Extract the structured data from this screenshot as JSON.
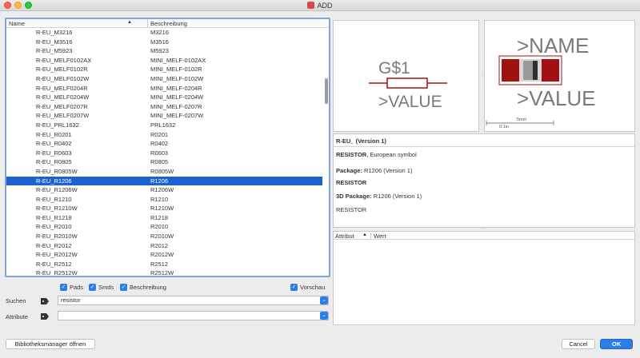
{
  "window": {
    "title": "ADD"
  },
  "list": {
    "columns": {
      "name": "Name",
      "sort_indicator": "▲",
      "description": "Beschreibung"
    },
    "selected_index": 16,
    "rows": [
      {
        "name": "R-EU_M3216",
        "desc": "M3216"
      },
      {
        "name": "R-EU_M3516",
        "desc": "M3516"
      },
      {
        "name": "R-EU_M5923",
        "desc": "M5923"
      },
      {
        "name": "R-EU_MELF0102AX",
        "desc": "MINI_MELF-0102AX"
      },
      {
        "name": "R-EU_MELF0102R",
        "desc": "MINI_MELF-0102R"
      },
      {
        "name": "R-EU_MELF0102W",
        "desc": "MINI_MELF-0102W"
      },
      {
        "name": "R-EU_MELF0204R",
        "desc": "MINI_MELF-0204R"
      },
      {
        "name": "R-EU_MELF0204W",
        "desc": "MINI_MELF-0204W"
      },
      {
        "name": "R-EU_MELF0207R",
        "desc": "MINI_MELF-0207R"
      },
      {
        "name": "R-EU_MELF0207W",
        "desc": "MINI_MELF-0207W"
      },
      {
        "name": "R-EU_PRL1632",
        "desc": "PRL1632"
      },
      {
        "name": "R-EU_R0201",
        "desc": "R0201"
      },
      {
        "name": "R-EU_R0402",
        "desc": "R0402"
      },
      {
        "name": "R-EU_R0603",
        "desc": "R0603"
      },
      {
        "name": "R-EU_R0805",
        "desc": "R0805"
      },
      {
        "name": "R-EU_R0805W",
        "desc": "R0805W"
      },
      {
        "name": "R-EU_R1206",
        "desc": "R1206"
      },
      {
        "name": "R-EU_R1206W",
        "desc": "R1206W"
      },
      {
        "name": "R-EU_R1210",
        "desc": "R1210"
      },
      {
        "name": "R-EU_R1210W",
        "desc": "R1210W"
      },
      {
        "name": "R-EU_R1218",
        "desc": "R1218"
      },
      {
        "name": "R-EU_R2010",
        "desc": "R2010"
      },
      {
        "name": "R-EU_R2010W",
        "desc": "R2010W"
      },
      {
        "name": "R-EU_R2012",
        "desc": "R2012"
      },
      {
        "name": "R-EU_R2012W",
        "desc": "R2012W"
      },
      {
        "name": "R-EU_R2512",
        "desc": "R2512"
      },
      {
        "name": "R-EU_R2512W",
        "desc": "R2512W"
      }
    ]
  },
  "options": {
    "pads": "Pads",
    "smds": "Smds",
    "description": "Beschreibung",
    "preview": "Vorschau"
  },
  "search": {
    "label": "Suchen",
    "value": "resistor"
  },
  "attribute": {
    "label": "Attribute",
    "value": ""
  },
  "buttons": {
    "library_manager": "Bibliotheksmanager öffnen",
    "cancel": "Cancel",
    "ok": "OK"
  },
  "symbol_preview": {
    "name": "G$1",
    "value": ">VALUE"
  },
  "package_preview": {
    "name": ">NAME",
    "value": ">VALUE",
    "scale_inch": "0.1in",
    "scale_mm": "5mm"
  },
  "info": {
    "title": "R-EU_ (Version 1)",
    "resistor_bold": "RESISTOR",
    "resistor_desc": ", European symbol",
    "package_label": "Package:",
    "package_value": " R1206 (Version 1)",
    "resistor_2": "RESISTOR",
    "pkg3d_label": "3D Package:",
    "pkg3d_value": " R1206 (Version 1)",
    "resistor_3": "RESISTOR"
  },
  "attr_table": {
    "col_attribute": "Attribut",
    "sort_indicator": "▲",
    "col_value": "Wert"
  },
  "colors": {
    "accent": "#2b7de9",
    "selection": "#1d61d3",
    "symbol_red": "#a01010",
    "symbol_gray": "#7a7a7a"
  }
}
